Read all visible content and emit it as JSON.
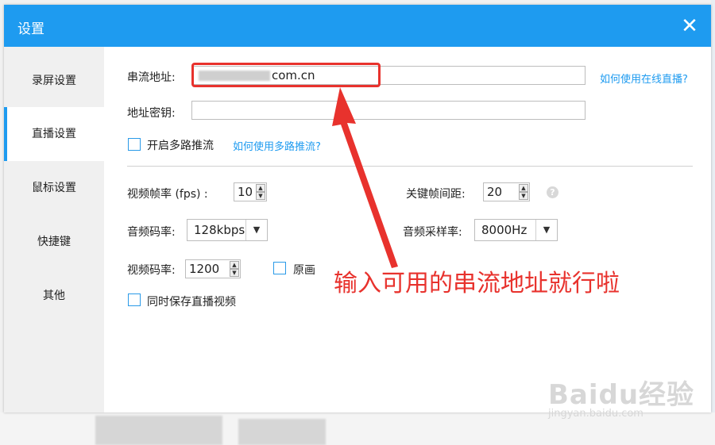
{
  "dialog": {
    "title": "设置",
    "close_glyph": "✕"
  },
  "sidebar": {
    "items": [
      {
        "label": "录屏设置",
        "active": false
      },
      {
        "label": "直播设置",
        "active": true
      },
      {
        "label": "鼠标设置",
        "active": false
      },
      {
        "label": "快捷键",
        "active": false
      },
      {
        "label": "其他",
        "active": false
      }
    ]
  },
  "stream": {
    "url_label": "串流地址:",
    "url_value": "com.cn",
    "help_link": "如何使用在线直播?",
    "key_label": "地址密钥:",
    "key_value": "",
    "multi_label": "开启多路推流",
    "multi_checked": false,
    "multi_link": "如何使用多路推流?"
  },
  "video": {
    "fps_label": "视频帧率 (fps) :",
    "fps_value": "10",
    "keyframe_label": "关键帧间距:",
    "keyframe_value": "20",
    "audio_bitrate_label": "音频码率:",
    "audio_bitrate_value": "128kbps",
    "audio_samplerate_label": "音频采样率:",
    "audio_samplerate_value": "8000Hz",
    "video_bitrate_label": "视频码率:",
    "video_bitrate_value": "1200",
    "original_label": "原画",
    "original_checked": false,
    "save_label": "同时保存直播视频",
    "save_checked": false,
    "help_glyph": "?"
  },
  "annotation": {
    "text": "输入可用的串流地址就行啦",
    "color": "#e8322d"
  },
  "watermark": {
    "logo": "Baidu经验",
    "url": "jingyan.baidu.com"
  },
  "colors": {
    "accent": "#1e9bf0",
    "annotation": "#e8322d"
  }
}
